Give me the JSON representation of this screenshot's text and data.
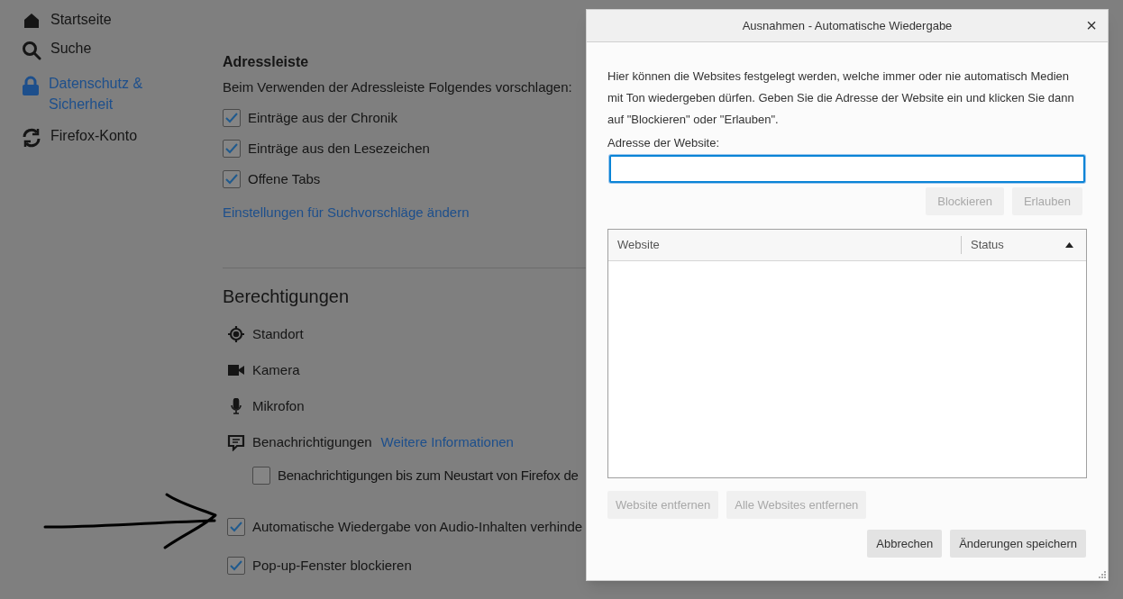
{
  "sidebar": {
    "items": [
      {
        "label": "Startseite",
        "kind": "home",
        "selected": false
      },
      {
        "label": "Suche",
        "kind": "search",
        "selected": false
      },
      {
        "label": "Datenschutz & Sicherheit",
        "kind": "lock",
        "selected": true
      },
      {
        "label": "Firefox-Konto",
        "kind": "sync",
        "selected": false
      }
    ]
  },
  "address_bar": {
    "heading": "Adressleiste",
    "description": "Beim Verwenden der Adressleiste Folgendes vorschlagen:",
    "options": [
      {
        "label": "Einträge aus der Chronik",
        "checked": true
      },
      {
        "label": "Einträge aus den Lesezeichen",
        "checked": true
      },
      {
        "label": "Offene Tabs",
        "checked": true
      }
    ],
    "link": "Einstellungen für Suchvorschläge ändern"
  },
  "permissions": {
    "heading": "Berechtigungen",
    "items": [
      {
        "label": "Standort",
        "kind": "location"
      },
      {
        "label": "Kamera",
        "kind": "camera"
      },
      {
        "label": "Mikrofon",
        "kind": "microphone"
      },
      {
        "label": "Benachrichtigungen",
        "kind": "notification",
        "link": "Weitere Informationen"
      }
    ],
    "notification_option": {
      "label": "Benachrichtigungen bis zum Neustart von Firefox de",
      "checked": false
    },
    "options": [
      {
        "label": "Automatische Wiedergabe von Audio-Inhalten verhinde",
        "checked": true
      },
      {
        "label": "Pop-up-Fenster blockieren",
        "checked": true
      }
    ]
  },
  "dialog": {
    "title": "Ausnahmen - Automatische Wiedergabe",
    "close": "×",
    "description": "Hier können die Websites festgelegt werden, welche immer oder nie automatisch Medien mit Ton wiedergeben dürfen. Geben Sie die Adresse der Website ein und klicken Sie dann auf \"Blockieren\" oder \"Erlauben\".",
    "field_label": "Adresse der Website:",
    "field_buttons": [
      {
        "label": "Blockieren",
        "disabled": true
      },
      {
        "label": "Erlauben",
        "disabled": true
      }
    ],
    "table": {
      "columns": [
        {
          "label": "Website",
          "sorted": false
        },
        {
          "label": "Status",
          "sorted": true
        }
      ]
    },
    "list_buttons": [
      {
        "label": "Website entfernen",
        "disabled": true
      },
      {
        "label": "Alle Websites entfernen",
        "disabled": true
      }
    ],
    "footer_buttons": [
      {
        "label": "Abbrechen",
        "disabled": false
      },
      {
        "label": "Änderungen speichern",
        "disabled": false
      }
    ]
  }
}
